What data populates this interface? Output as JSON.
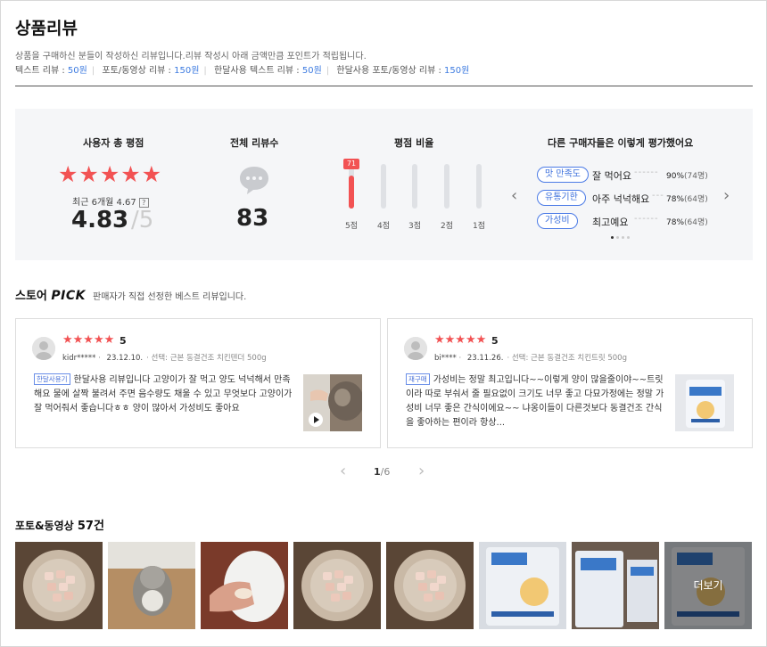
{
  "page_title": "상품리뷰",
  "description": "상품을 구매하신 분들이 작성하신 리뷰입니다.리뷰 작성시 아래 금액만큼 포인트가 적립됩니다.",
  "points": [
    {
      "label": "텍스트 리뷰 :",
      "amount": "50원"
    },
    {
      "label": "포토/동영상 리뷰 :",
      "amount": "150원"
    },
    {
      "label": "한달사용 텍스트 리뷰 :",
      "amount": "50원"
    },
    {
      "label": "한달사용 포토/동영상 리뷰 :",
      "amount": "150원"
    }
  ],
  "summary": {
    "avg_title": "사용자 총 평점",
    "stars": "★★★★★",
    "recent_label": "최근 6개월 4.67",
    "help_icon": "?",
    "rating": "4.83",
    "rating_max": "/5",
    "total_title": "전체 리뷰수",
    "total_icon": "speech-bubble-icon",
    "total_count": "83",
    "ratio_title": "평점 비율",
    "ratio": [
      {
        "label": "5점",
        "value": 71,
        "badge": "71"
      },
      {
        "label": "4점",
        "value": 0
      },
      {
        "label": "3점",
        "value": 0
      },
      {
        "label": "2점",
        "value": 0
      },
      {
        "label": "1점",
        "value": 0
      }
    ],
    "eval_title": "다른 구매자들은 이렇게 평가했어요",
    "evals": [
      {
        "tag": "맛 만족도",
        "text": "잘 먹어요",
        "dots": "------",
        "pct": "90%",
        "count": "(74명)"
      },
      {
        "tag": "유통기한",
        "text": "아주 넉넉해요",
        "dots": "---",
        "pct": "78%",
        "count": "(64명)"
      },
      {
        "tag": "가성비",
        "text": "최고예요",
        "dots": "------",
        "pct": "78%",
        "count": "(64명)"
      }
    ],
    "prev_arrow": "‹",
    "next_arrow": "›"
  },
  "pick": {
    "prefix": "스토어",
    "pick_word": "PICK",
    "desc": "판매자가 직접 선정한 베스트 리뷰입니다."
  },
  "cards": [
    {
      "stars": "★★★★★",
      "score": "5",
      "user": "kidr*****",
      "date": "23.12.10.",
      "option": "선택: 근본 동결건조 치킨텐더 500g",
      "tag": "한달사용기",
      "body": "한달사용 리뷰입니다 고양이가 잘 먹고 양도 넉넉해서 만족해요 물에 살짝 불려서 주면 음수량도 채울 수 있고 무엇보다 고양이가 잘 먹어줘서 좋습니다ㅎㅎ 양이 많아서 가성비도 좋아요"
    },
    {
      "stars": "★★★★★",
      "score": "5",
      "user": "bi****",
      "date": "23.11.26.",
      "option": "선택: 근본 동결건조 치킨트릿 500g",
      "tag": "재구매",
      "body": "가성비는 정말 최고입니다~~이렇게 양이 많을줄이야~~트릿이라 따로 부숴서 줄 필요없이 크기도 너무 좋고 다묘가정에는 정말 가성비 너무 좋은 간식이에요~~ 냐옹이들이 다른것보다 동결건조 간식을 좋아하는 편이라 항상..."
    }
  ],
  "pagination": {
    "current": "1",
    "total": "/6",
    "prev": "‹",
    "next": "›"
  },
  "photos": {
    "title": "포토&동영상",
    "count": "57건",
    "more_label": "더보기"
  }
}
